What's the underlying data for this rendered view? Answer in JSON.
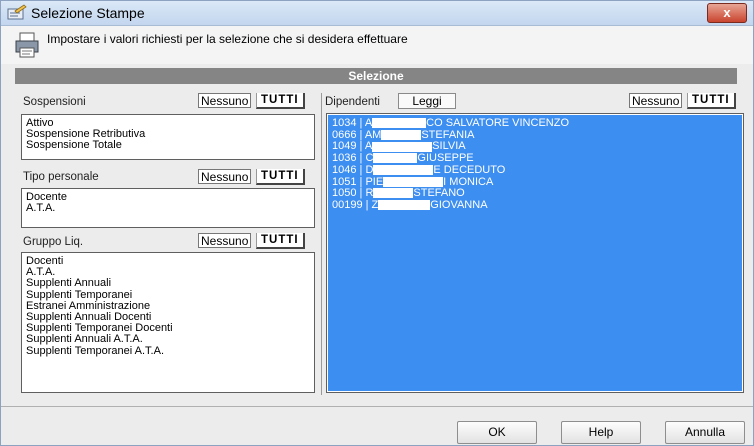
{
  "window": {
    "title": "Selezione Stampe",
    "close_label": "x"
  },
  "header": {
    "text": "Impostare i valori richiesti per la selezione che si desidera effettuare"
  },
  "section": {
    "title": "Selezione"
  },
  "sospensioni": {
    "label": "Sospensioni",
    "nessuno": "Nessuno",
    "tutti": "TUTTI",
    "items": [
      "Attivo",
      "Sospensione Retributiva",
      "Sospensione Totale"
    ]
  },
  "tipo_personale": {
    "label": "Tipo personale",
    "nessuno": "Nessuno",
    "tutti": "TUTTI",
    "items": [
      "Docente",
      "A.T.A."
    ]
  },
  "gruppo_liq": {
    "label": "Gruppo Liq.",
    "nessuno": "Nessuno",
    "tutti": "TUTTI",
    "items": [
      "Docenti",
      "A.T.A.",
      "Supplenti Annuali",
      "Supplenti Temporanei",
      "Estranei Amministrazione",
      "Supplenti Annuali Docenti",
      "Supplenti Temporanei Docenti",
      "Supplenti Annuali A.T.A.",
      "Supplenti Temporanei A.T.A."
    ]
  },
  "dipendenti": {
    "label": "Dipendenti",
    "leggi": "Leggi",
    "nessuno": "Nessuno",
    "tutti": "TUTTI",
    "items": [
      {
        "id": "1034 | A",
        "rest": "CO SALVATORE VINCENZO"
      },
      {
        "id": "0666 | AM",
        "rest": "STEFANIA"
      },
      {
        "id": "1049 | A",
        "rest": "SILVIA"
      },
      {
        "id": "1036 | C",
        "rest": "GIUSEPPE"
      },
      {
        "id": "1046 | D",
        "rest": "E DECEDUTO"
      },
      {
        "id": "1051 | PIE",
        "rest": "I MONICA"
      },
      {
        "id": "1050 | R",
        "rest": "STEFANO"
      },
      {
        "id": "00199 | Z",
        "rest": "GIOVANNA"
      }
    ]
  },
  "footer": {
    "ok": "OK",
    "help": "Help",
    "annulla": "Annulla"
  }
}
